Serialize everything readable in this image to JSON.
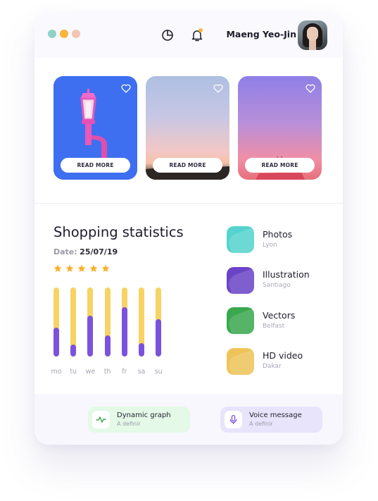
{
  "header": {
    "window_dots": [
      "#8fd1c6",
      "#f9b63c",
      "#f2c6b2"
    ],
    "icons": [
      "pie-chart-icon",
      "bell-icon"
    ],
    "user_name": "Maeng Yeo-Jin"
  },
  "gallery": {
    "cards": [
      {
        "image": "pink-street-lamp",
        "button_label": "READ MORE",
        "icon": "heart-icon"
      },
      {
        "image": "dusk-sky-silhouette",
        "button_label": "READ MORE",
        "icon": "heart-icon"
      },
      {
        "image": "purple-pink-sky",
        "button_label": "READ MORE",
        "icon": "heart-icon"
      }
    ]
  },
  "statistics": {
    "title": "Shopping statistics",
    "date_label": "Date:",
    "date_value": "25/07/19",
    "rating_stars": 5,
    "star_color": "#f9b12b",
    "days": [
      "mo",
      "tu",
      "we",
      "th",
      "fr",
      "sa",
      "su"
    ],
    "fill_fraction": [
      0.42,
      0.17,
      0.59,
      0.31,
      0.71,
      0.19,
      0.54
    ],
    "track_color": "#f7d365",
    "fill_color": "#7b52dd"
  },
  "categories": [
    {
      "title": "Photos",
      "subtitle": "Lyon",
      "color": "#56d3ce"
    },
    {
      "title": "Illustration",
      "subtitle": "Santiago",
      "color": "#6a44c6"
    },
    {
      "title": "Vectors",
      "subtitle": "Belfast",
      "color": "#3aa84e"
    },
    {
      "title": "HD video",
      "subtitle": "Dakar",
      "color": "#eec45a"
    }
  ],
  "footer": {
    "actions": [
      {
        "title": "Dynamic graph",
        "subtitle": "A definir",
        "icon": "activity-icon",
        "color": "#e4f9e8"
      },
      {
        "title": "Voice message",
        "subtitle": "A definir",
        "icon": "microphone-icon",
        "color": "#e8e4fb"
      }
    ]
  }
}
